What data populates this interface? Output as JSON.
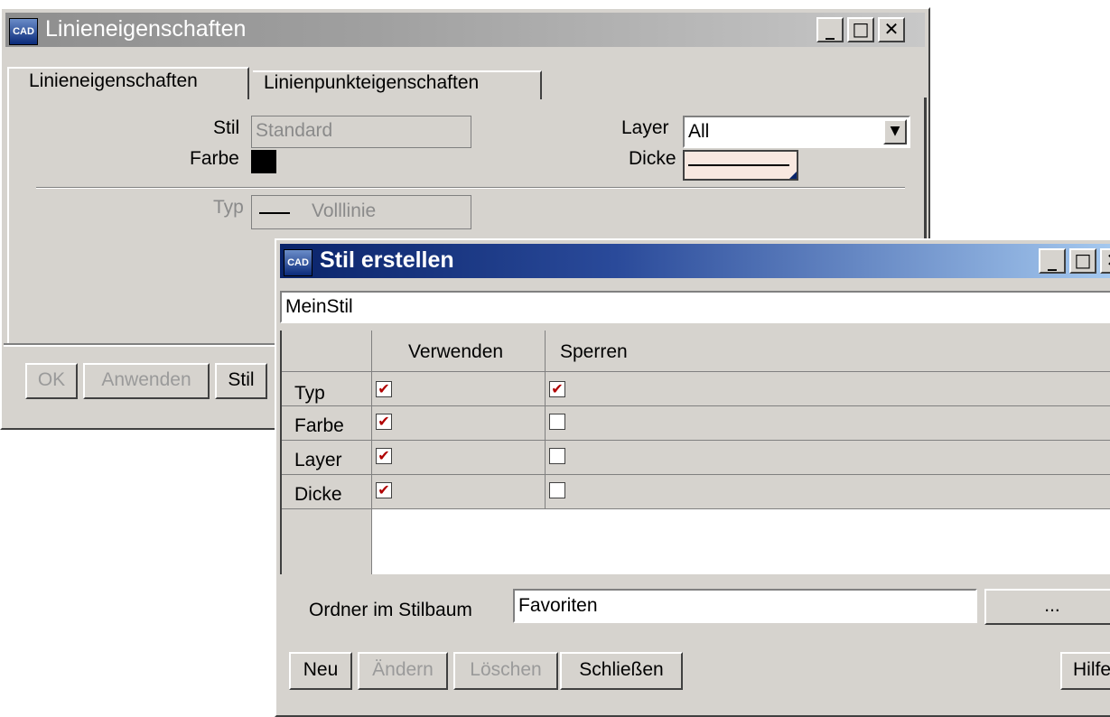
{
  "win1": {
    "title": "Linieneigenschaften",
    "tabs": [
      "Linieneigenschaften",
      "Linienpunkteigenschaften"
    ],
    "stil_label": "Stil",
    "stil_value": "Standard",
    "farbe_label": "Farbe",
    "farbe_color": "#000000",
    "layer_label": "Layer",
    "layer_value": "All",
    "dicke_label": "Dicke",
    "typ_label": "Typ",
    "typ_value": "Volllinie",
    "buttons": [
      "OK",
      "Anwenden",
      "Stil"
    ]
  },
  "win2": {
    "title": "Stil erstellen",
    "name_value": "MeinStil",
    "columns": [
      "Verwenden",
      "Sperren"
    ],
    "rows": [
      {
        "label": "Typ",
        "verwenden": true,
        "sperren": true
      },
      {
        "label": "Farbe",
        "verwenden": true,
        "sperren": false
      },
      {
        "label": "Layer",
        "verwenden": true,
        "sperren": false
      },
      {
        "label": "Dicke",
        "verwenden": true,
        "sperren": false
      }
    ],
    "folder_label": "Ordner im Stilbaum",
    "folder_value": "Favoriten",
    "browse_label": "...",
    "buttons": [
      "Neu",
      "Ändern",
      "Löschen",
      "Schließen",
      "Hilfe"
    ]
  },
  "icons": {
    "app": "cad-app-icon",
    "minimize": "minimize-icon",
    "maximize": "maximize-icon",
    "close": "close-icon",
    "dropdown": "chevron-down-icon",
    "check": "checkmark-icon"
  },
  "colors": {
    "title_active": "#0a246a",
    "title_inactive": "#8e8e8e",
    "check": "#b00000",
    "dicke_bg": "#f8e8e0"
  }
}
